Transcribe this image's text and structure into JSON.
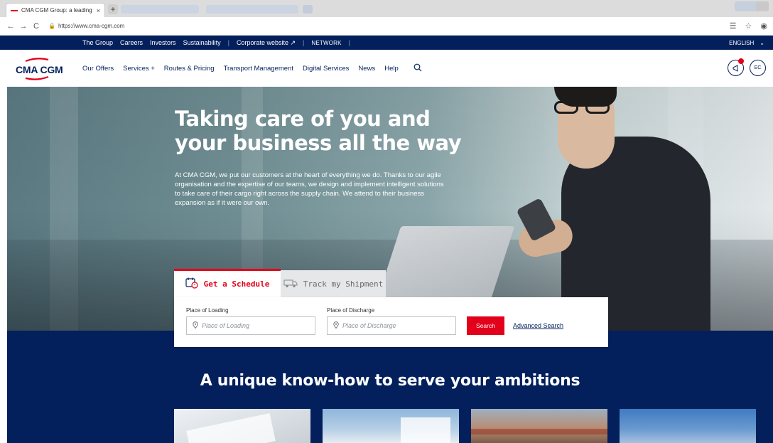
{
  "browser": {
    "tab_title": "CMA CGM Group: a leading worl",
    "tab_close": "×",
    "newtab": "+",
    "url": "https://www.cma-cgm.com",
    "nav_back": "←",
    "nav_forward": "→",
    "nav_reload": "C"
  },
  "topbar": {
    "links": [
      "The Group",
      "Careers",
      "Investors",
      "Sustainability"
    ],
    "corporate": "Corporate website ↗",
    "network": "NETWORK",
    "language": "ENGLISH"
  },
  "nav": {
    "logo": "CMA CGM",
    "items": [
      "Our Offers",
      "Services +",
      "Routes & Pricing",
      "Transport Management",
      "Digital Services",
      "News",
      "Help"
    ],
    "user_initials": "EC"
  },
  "hero": {
    "title_line1": "Taking care of you and",
    "title_line2": "your business all the way",
    "description": "At CMA CGM, we put our customers at the heart of everything we do. Thanks to our agile organisation and the expertise of our teams, we design and implement intelligent solutions to take care of their cargo right across the supply chain. We attend to their business expansion as if it were our own."
  },
  "widget": {
    "tabs": [
      {
        "label": "Get a Schedule",
        "icon": "calendar-clock-icon",
        "active": true
      },
      {
        "label": "Track my Shipment",
        "icon": "truck-icon",
        "active": false
      }
    ],
    "loading_label": "Place of Loading",
    "loading_placeholder": "Place of Loading",
    "discharge_label": "Place of Discharge",
    "discharge_placeholder": "Place of Discharge",
    "search_label": "Search",
    "advanced_label": "Advanced Search"
  },
  "section": {
    "title": "A unique know-how to serve your ambitions"
  },
  "colors": {
    "brand_blue": "#03205c",
    "brand_red": "#e2001a"
  }
}
